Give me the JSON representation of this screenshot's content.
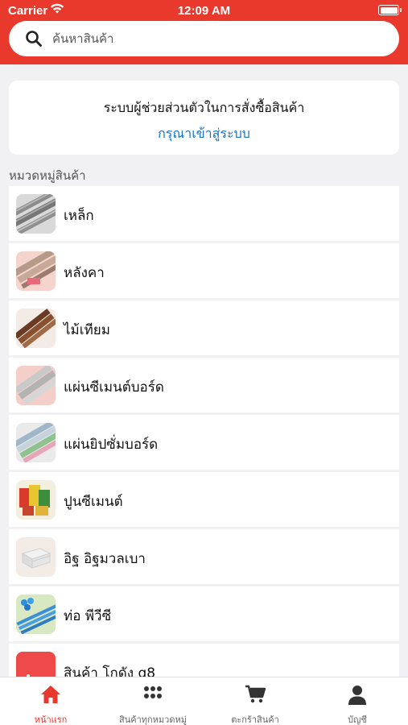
{
  "status_bar": {
    "carrier": "Carrier",
    "time": "12:09 AM"
  },
  "search": {
    "placeholder": "ค้นหาสินค้า"
  },
  "assistant": {
    "title": "ระบบผู้ช่วยส่วนตัวในการสั่งซื้อสินค้า",
    "login_link": "กรุณาเข้าสู่ระบบ"
  },
  "categories": {
    "heading": "หมวดหมู่สินค้า",
    "items": [
      {
        "label": "เหล็ก",
        "thumb": "steel-thumbnail"
      },
      {
        "label": "หลังคา",
        "thumb": "roof-thumbnail"
      },
      {
        "label": "ไม้เทียม",
        "thumb": "artificial-wood-thumbnail"
      },
      {
        "label": "แผ่นซีเมนต์บอร์ด",
        "thumb": "cement-board-thumbnail"
      },
      {
        "label": "แผ่นยิปซั่มบอร์ด",
        "thumb": "gypsum-board-thumbnail"
      },
      {
        "label": "ปูนซีเมนต์",
        "thumb": "cement-thumbnail"
      },
      {
        "label": "อิฐ อิฐมวลเบา",
        "thumb": "brick-thumbnail"
      },
      {
        "label": "ท่อ พีวีซี",
        "thumb": "pvc-pipe-thumbnail"
      },
      {
        "label": "สินค้า โกดัง q8",
        "thumb": "warehouse-thumbnail"
      }
    ]
  },
  "tabbar": {
    "items": [
      {
        "label": "หน้าแรก",
        "icon": "home-icon",
        "active": true
      },
      {
        "label": "สินค้าทุกหมวดหมู่",
        "icon": "grid-icon",
        "active": false
      },
      {
        "label": "ตะกร้าสินค้า",
        "icon": "cart-icon",
        "active": false
      },
      {
        "label": "บัญชี",
        "icon": "user-icon",
        "active": false
      }
    ]
  },
  "colors": {
    "brand": "#e8392c",
    "link": "#1a73c7",
    "background": "#f1f1f3"
  }
}
